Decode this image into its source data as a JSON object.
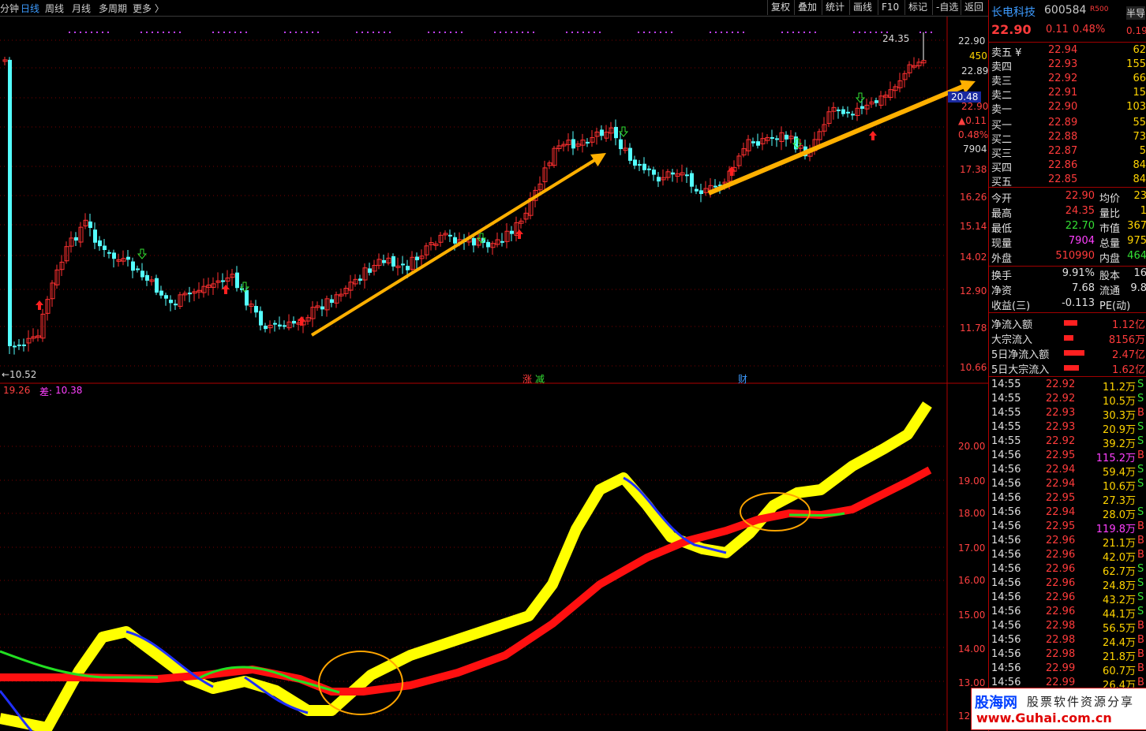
{
  "topbar": {
    "tabs": [
      "分钟",
      "日线",
      "周线",
      "月线",
      "多周期",
      "更多 〉"
    ],
    "active_tab": "日线",
    "tools": [
      "复权",
      "叠加",
      "统计",
      "画线",
      "F10",
      "标记",
      "-自选",
      "返回"
    ]
  },
  "main_chart": {
    "price_axis": [
      "22.90",
      "450",
      "22.89",
      "20.48",
      "22.90",
      "▲0.11",
      "0.48%",
      "7904",
      "17.38",
      "16.26",
      "15.14",
      "14.02",
      "12.90",
      "11.78",
      "10.66"
    ],
    "labels": {
      "high": "24.35",
      "low": "←10.52",
      "markers": [
        "涨",
        "减",
        "财"
      ]
    }
  },
  "indicator": {
    "header_value1": "19.26",
    "header_label2": "差:",
    "header_value2": "10.38",
    "axis": [
      "20.00",
      "19.00",
      "18.00",
      "17.00",
      "16.00",
      "15.00",
      "14.00",
      "13.00",
      "12"
    ]
  },
  "quote": {
    "name": "长电科技",
    "code": "600584",
    "tag": "R500",
    "corner_label": "半导",
    "price": "22.90",
    "change": "0.11",
    "change_pct": "0.48%",
    "side_value": "0.19",
    "sells": [
      {
        "label": "卖五 ¥",
        "price": "22.94",
        "vol": "62"
      },
      {
        "label": "卖四",
        "price": "22.93",
        "vol": "155"
      },
      {
        "label": "卖三",
        "price": "22.92",
        "vol": "66"
      },
      {
        "label": "卖二",
        "price": "22.91",
        "vol": "15"
      },
      {
        "label": "卖一",
        "price": "22.90",
        "vol": "103"
      }
    ],
    "buys": [
      {
        "label": "买一",
        "price": "22.89",
        "vol": "55"
      },
      {
        "label": "买二",
        "price": "22.88",
        "vol": "73"
      },
      {
        "label": "买三",
        "price": "22.87",
        "vol": "5"
      },
      {
        "label": "买四",
        "price": "22.86",
        "vol": "84"
      },
      {
        "label": "买五",
        "price": "22.85",
        "vol": "84"
      }
    ],
    "stats": [
      {
        "l1": "今开",
        "v1": "22.90",
        "l2": "均价",
        "v2": "23"
      },
      {
        "l1": "最高",
        "v1": "24.35",
        "l2": "量比",
        "v2": "1"
      },
      {
        "l1": "最低",
        "v1": "22.70",
        "l2": "市值",
        "v2": "367"
      },
      {
        "l1": "现量",
        "v1": "7904",
        "l2": "总量",
        "v2": "975"
      },
      {
        "l1": "外盘",
        "v1": "510990",
        "l2": "内盘",
        "v2": "464"
      }
    ],
    "stats2": [
      {
        "l1": "换手",
        "v1": "9.91%",
        "l2": "股本",
        "v2": "16"
      },
      {
        "l1": "净资",
        "v1": "7.68",
        "l2": "流通",
        "v2": "9.8"
      },
      {
        "l1": "收益(三)",
        "v1": "-0.113",
        "l2": "PE(动)",
        "v2": ""
      }
    ],
    "flows": [
      {
        "label": "净流入额",
        "value": "1.12亿",
        "bar": 0.55
      },
      {
        "label": "大宗流入",
        "value": "8156万",
        "bar": 0.3
      },
      {
        "label": "5日净流入额",
        "value": "2.47亿",
        "bar": 1.0
      },
      {
        "label": "5日大宗流入",
        "value": "1.62亿",
        "bar": 0.65
      }
    ],
    "ticks": [
      {
        "t": "14:55",
        "p": "22.92",
        "v": "11.2万",
        "s": "S"
      },
      {
        "t": "14:55",
        "p": "22.92",
        "v": "10.5万",
        "s": "S"
      },
      {
        "t": "14:55",
        "p": "22.93",
        "v": "30.3万",
        "s": "B"
      },
      {
        "t": "14:55",
        "p": "22.93",
        "v": "20.9万",
        "s": "S"
      },
      {
        "t": "14:55",
        "p": "22.92",
        "v": "39.2万",
        "s": "S"
      },
      {
        "t": "14:56",
        "p": "22.95",
        "v": "115.2万",
        "s": "B"
      },
      {
        "t": "14:56",
        "p": "22.94",
        "v": "59.4万",
        "s": "S"
      },
      {
        "t": "14:56",
        "p": "22.94",
        "v": "10.6万",
        "s": "S"
      },
      {
        "t": "14:56",
        "p": "22.95",
        "v": "27.3万",
        "s": ""
      },
      {
        "t": "14:56",
        "p": "22.94",
        "v": "28.0万",
        "s": "S"
      },
      {
        "t": "14:56",
        "p": "22.95",
        "v": "119.8万",
        "s": "B"
      },
      {
        "t": "14:56",
        "p": "22.96",
        "v": "21.1万",
        "s": "B"
      },
      {
        "t": "14:56",
        "p": "22.96",
        "v": "42.0万",
        "s": "B"
      },
      {
        "t": "14:56",
        "p": "22.96",
        "v": "62.7万",
        "s": "S"
      },
      {
        "t": "14:56",
        "p": "22.96",
        "v": "24.8万",
        "s": "S"
      },
      {
        "t": "14:56",
        "p": "22.96",
        "v": "43.2万",
        "s": "S"
      },
      {
        "t": "14:56",
        "p": "22.96",
        "v": "44.1万",
        "s": "S"
      },
      {
        "t": "14:56",
        "p": "22.98",
        "v": "56.5万",
        "s": "B"
      },
      {
        "t": "14:56",
        "p": "22.98",
        "v": "24.4万",
        "s": "B"
      },
      {
        "t": "14:56",
        "p": "22.98",
        "v": "21.8万",
        "s": "B"
      },
      {
        "t": "14:56",
        "p": "22.99",
        "v": "60.7万",
        "s": "B"
      },
      {
        "t": "14:56",
        "p": "22.99",
        "v": "26.4万",
        "s": "B"
      }
    ]
  },
  "watermark": {
    "brand": "股海网",
    "slogan": "股票软件资源分享",
    "url": "www.Guhai.com.cn"
  }
}
